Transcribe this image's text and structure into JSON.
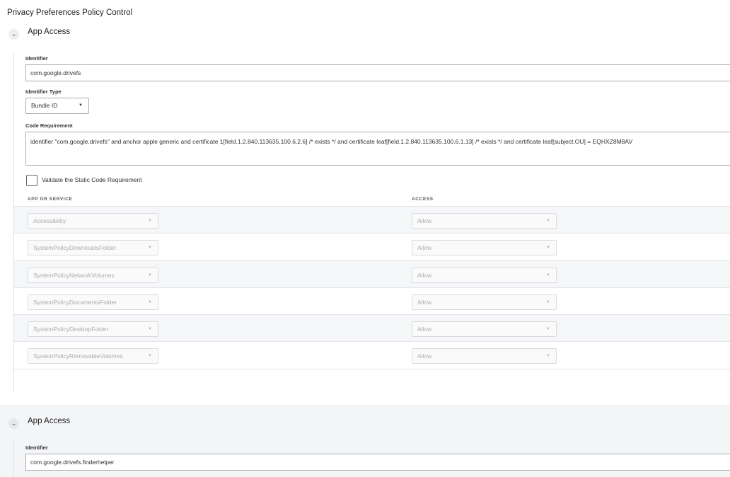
{
  "page_title": "Privacy Preferences Policy Control",
  "sections": [
    {
      "title": "App Access",
      "identifier_label": "Identifier",
      "identifier_value": "com.google.drivefs",
      "identifier_type_label": "Identifier Type",
      "identifier_type_value": "Bundle ID",
      "code_requirement_label": "Code Requirement",
      "code_requirement_value": "identifier \"com.google.drivefs\" and anchor apple generic and certificate 1[field.1.2.840.113635.100.6.2.6] /* exists */ and certificate leaf[field.1.2.840.113635.100.6.1.13] /* exists */ and certificate leaf[subject.OU] = EQHXZ8M8AV",
      "validate_label": "Validate the Static Code Requirement",
      "table": {
        "col_service": "APP OR SERVICE",
        "col_access": "ACCESS",
        "rows": [
          {
            "service": "Accessibility",
            "access": "Allow"
          },
          {
            "service": "SystemPolicyDownloadsFolder",
            "access": "Allow"
          },
          {
            "service": "SystemPolicyNetworkVolumes",
            "access": "Allow"
          },
          {
            "service": "SystemPolicyDocumentsFolder",
            "access": "Allow"
          },
          {
            "service": "SystemPolicyDesktopFolder",
            "access": "Allow"
          },
          {
            "service": "SystemPolicyRemovableVolumes",
            "access": "Allow"
          }
        ]
      }
    },
    {
      "title": "App Access",
      "identifier_label": "Identifier",
      "identifier_value": "com.google.drivefs.finderhelper"
    }
  ],
  "icons": {
    "chevron": "chevron-down-icon",
    "caret": "caret-down-icon"
  },
  "colors": {
    "border": "#a9adb4",
    "shaded_row": "#f5f6f8",
    "disabled_text": "#a8abb0"
  }
}
